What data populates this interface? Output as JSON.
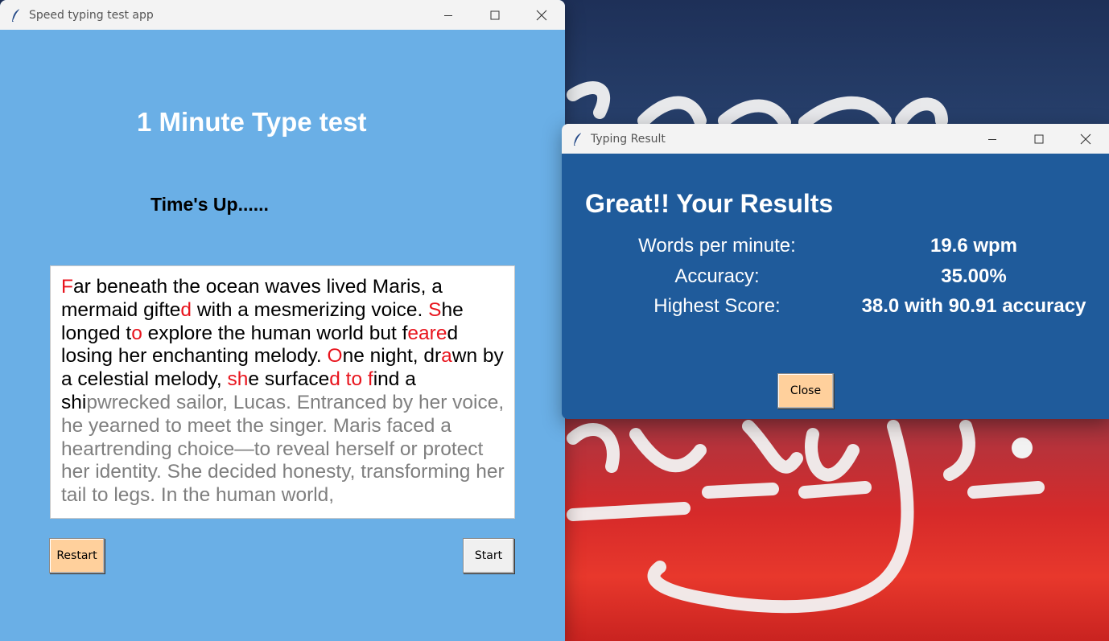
{
  "main_window": {
    "title": "Speed typing test app",
    "heading": "1 Minute Type test",
    "status": "Time's Up......",
    "text_segments": [
      {
        "t": "F",
        "c": "err"
      },
      {
        "t": "ar beneath the ocean waves lived Maris, a mermaid gifte",
        "c": "ok"
      },
      {
        "t": "d",
        "c": "err"
      },
      {
        "t": " with a mesmerizing voice. ",
        "c": "ok"
      },
      {
        "t": "S",
        "c": "err"
      },
      {
        "t": "he longed t",
        "c": "ok"
      },
      {
        "t": "o",
        "c": "err"
      },
      {
        "t": " explore the human world but f",
        "c": "ok"
      },
      {
        "t": "eare",
        "c": "err"
      },
      {
        "t": "d losing her enchanting melody. ",
        "c": "ok"
      },
      {
        "t": "O",
        "c": "err"
      },
      {
        "t": "ne night, dr",
        "c": "ok"
      },
      {
        "t": "a",
        "c": "err"
      },
      {
        "t": "wn by a celestial melody, ",
        "c": "ok"
      },
      {
        "t": "sh",
        "c": "err"
      },
      {
        "t": "e surface",
        "c": "ok"
      },
      {
        "t": "d to f",
        "c": "err"
      },
      {
        "t": "ind a shi",
        "c": "ok"
      },
      {
        "t": "pwrecked sailor, Lucas. Entranced by her voice, he yearned to meet the singer. Maris faced a heartrending choice—to reveal herself or protect her identity. She decided honesty, transforming her tail to legs. In the human world,",
        "c": "rest"
      }
    ],
    "restart_label": "Restart",
    "start_label": "Start"
  },
  "result_window": {
    "title": "Typing Result",
    "heading": "Great!! Your Results",
    "rows": [
      {
        "label": "Words per minute:",
        "value": "19.6 wpm"
      },
      {
        "label": "Accuracy:",
        "value": "35.00%"
      },
      {
        "label": "Highest Score:",
        "value": "38.0 with 90.91 accuracy"
      }
    ],
    "close_label": "Close"
  },
  "icons": {
    "app_icon": "feather-icon",
    "minimize": "minimize-icon",
    "maximize": "maximize-icon",
    "close": "close-icon"
  },
  "colors": {
    "main_bg": "#6aafe6",
    "result_bg": "#1f5b9b",
    "button_accent": "#ffd09c",
    "error_text": "#e8141d",
    "untyped_text": "#7f7f7f"
  }
}
